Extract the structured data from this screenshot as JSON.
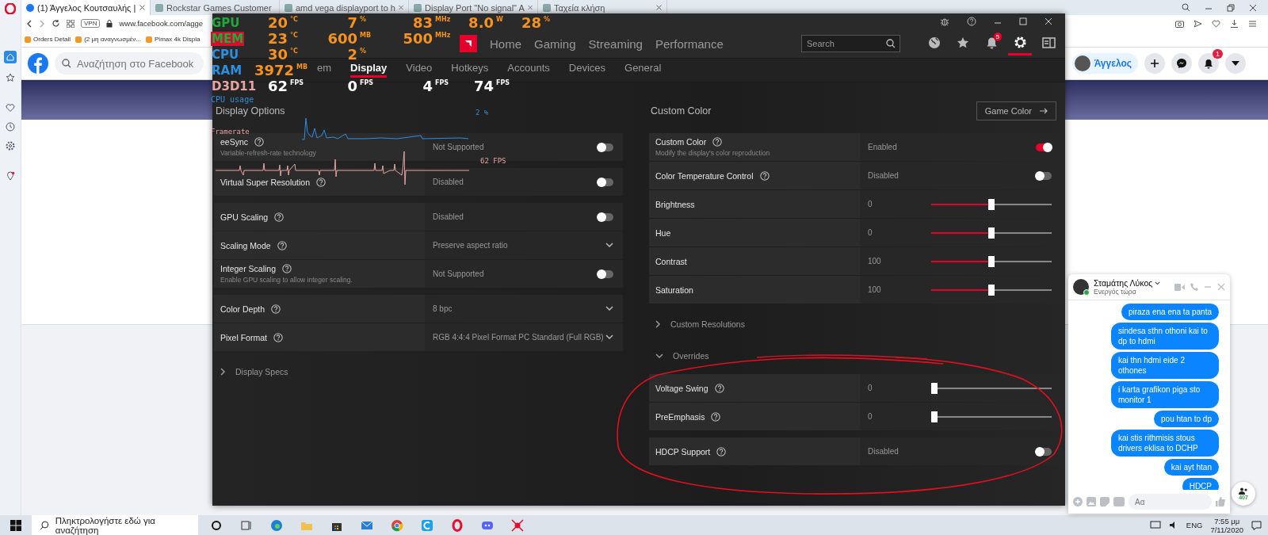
{
  "browser": {
    "tabs": [
      {
        "title": "(1) Άγγελος Κουτσαυλής |",
        "selected": true
      },
      {
        "title": "Rockstar Games Customer",
        "selected": false
      },
      {
        "title": "amd vega displayport to h",
        "selected": false
      },
      {
        "title": "Display Port \"No signal\" A",
        "selected": false
      },
      {
        "title": "Ταχεία κλήση",
        "selected": false
      }
    ],
    "vpn": "VPN",
    "address": "www.facebook.com/agge",
    "bookmarks": [
      {
        "label": "Orders Detail"
      },
      {
        "label": "(2 μη αναγνωσμέν..."
      },
      {
        "label": "Pimax 4k Displa"
      }
    ]
  },
  "facebook": {
    "search_placeholder": "Αναζήτηση στο Facebook",
    "profile_name": "Άγγελος",
    "notification_count": "1"
  },
  "amd": {
    "top_nav": [
      {
        "label": "Home",
        "selected": false
      },
      {
        "label": "Gaming",
        "selected": false
      },
      {
        "label": "Streaming",
        "selected": false
      },
      {
        "label": "Performance",
        "selected": false
      }
    ],
    "search_placeholder": "Search",
    "toolbar": [
      {
        "kind": "globe",
        "selected": false
      },
      {
        "kind": "star",
        "selected": false
      },
      {
        "kind": "bell",
        "badge": "5",
        "selected": false
      },
      {
        "kind": "gear",
        "selected": true
      },
      {
        "kind": "panel",
        "selected": false
      }
    ],
    "sub_tabs": [
      {
        "label": "em",
        "selected": false
      },
      {
        "label": "Display",
        "selected": true
      },
      {
        "label": "Video",
        "selected": false
      },
      {
        "label": "Hotkeys",
        "selected": false
      },
      {
        "label": "Accounts",
        "selected": false
      },
      {
        "label": "Devices",
        "selected": false
      },
      {
        "label": "General",
        "selected": false
      }
    ],
    "left_panel": {
      "title": "Display Options",
      "items": [
        {
          "kind": "group",
          "rows": [
            {
              "kind": "toggle",
              "label": "eeSync",
              "help": true,
              "subtitle": "Variable-refresh-rate technology",
              "value": "Not Supported",
              "on": false
            }
          ]
        },
        {
          "kind": "group",
          "rows": [
            {
              "kind": "toggle",
              "label": "Virtual Super Resolution",
              "help": true,
              "value": "Disabled",
              "on": false
            }
          ]
        },
        {
          "kind": "group",
          "rows": [
            {
              "kind": "toggle",
              "label": "GPU Scaling",
              "help": true,
              "value": "Disabled",
              "on": false
            },
            {
              "kind": "dropdown",
              "label": "Scaling Mode",
              "help": true,
              "value": "Preserve aspect ratio"
            },
            {
              "kind": "toggle",
              "label": "Integer Scaling",
              "help": true,
              "subtitle": "Enable GPU scaling to allow integer scaling.",
              "value": "Not Supported",
              "on": false
            }
          ]
        },
        {
          "kind": "group",
          "rows": [
            {
              "kind": "dropdown",
              "label": "Color Depth",
              "help": true,
              "value": "8 bpc"
            },
            {
              "kind": "dropdown",
              "label": "Pixel Format",
              "help": true,
              "value": "RGB 4:4:4 Pixel Format PC Standard (Full RGB)"
            }
          ]
        },
        {
          "kind": "expander",
          "label": "Display Specs",
          "expanded": false
        }
      ]
    },
    "right_panel": {
      "title": "Custom Color",
      "button": "Game Color",
      "items": [
        {
          "kind": "group",
          "rows": [
            {
              "kind": "toggle",
              "label": "Custom Color",
              "help": true,
              "subtitle": "Modify the display's color reproduction",
              "value": "Enabled",
              "on": true
            },
            {
              "kind": "toggle",
              "label": "Color Temperature Control",
              "help": true,
              "value": "Disabled",
              "on": false
            },
            {
              "kind": "slider",
              "label": "Brightness",
              "help": false,
              "value": "0",
              "level": 0.5
            },
            {
              "kind": "slider",
              "label": "Hue",
              "help": false,
              "value": "0",
              "level": 0.5
            },
            {
              "kind": "slider",
              "label": "Contrast",
              "help": false,
              "value": "100",
              "level": 0.5
            },
            {
              "kind": "slider",
              "label": "Saturation",
              "help": false,
              "value": "100",
              "level": 0.5
            }
          ]
        },
        {
          "kind": "expander",
          "label": "Custom Resolutions",
          "expanded": false
        },
        {
          "kind": "expander",
          "label": "Overrides",
          "expanded": true
        },
        {
          "kind": "group",
          "rows": [
            {
              "kind": "slider",
              "label": "Voltage Swing",
              "help": true,
              "value": "0",
              "level": 0
            },
            {
              "kind": "slider",
              "label": "PreEmphasis",
              "help": true,
              "value": "0",
              "level": 0
            }
          ]
        },
        {
          "kind": "group",
          "rows": [
            {
              "kind": "toggle",
              "label": "HDCP Support",
              "help": true,
              "value": "Disabled",
              "on": false
            }
          ]
        }
      ]
    }
  },
  "osd": {
    "rows": [
      {
        "kind": "gpu",
        "label": "GPU",
        "cells": [
          {
            "value": "20",
            "unit": "°C"
          },
          {
            "value": "7",
            "unit": "%"
          },
          {
            "value": "83",
            "unit": "MHz"
          },
          {
            "value": "8.0",
            "unit": "W"
          },
          {
            "value": "28",
            "unit": "%"
          }
        ]
      },
      {
        "kind": "mem",
        "label": "MEM",
        "cells": [
          {
            "value": "23",
            "unit": "°C"
          },
          {
            "value": "600",
            "unit": "MB"
          },
          {
            "value": "500",
            "unit": "MHz"
          }
        ]
      },
      {
        "kind": "cpu",
        "label": "CPU",
        "cells": [
          {
            "value": "30",
            "unit": "°C"
          },
          {
            "value": "2",
            "unit": "%"
          }
        ]
      },
      {
        "kind": "ram",
        "label": "RAM",
        "cells": [
          {
            "value": "3972",
            "unit": "MB"
          }
        ]
      },
      {
        "kind": "d3d",
        "label": "D3D11",
        "cells": [
          {
            "value": "62",
            "unit": "FPS"
          },
          {
            "value": "0",
            "unit": "FPS"
          },
          {
            "value": "4",
            "unit": "FPS"
          },
          {
            "value": "74",
            "unit": "FPS"
          }
        ]
      }
    ],
    "cpu_graph": {
      "label": "CPU usage",
      "reading": "2 %"
    },
    "fps_graph": {
      "label": "Framerate",
      "reading": "62 FPS"
    }
  },
  "chat": {
    "name": "Σταμάτης Λύκος",
    "status": "Ενεργός τώρα",
    "messages": [
      {
        "text": "piraza ena ena ta panta"
      },
      {
        "text": "sindesa sthn othoni kai to dp to hdmi"
      },
      {
        "text": "kai thn hdmi eide 2 othones"
      },
      {
        "text": "i karta grafikon piga sto monitor 1"
      },
      {
        "text": "pou htan to dp"
      },
      {
        "text": "kai stis rithmisis stous drivers eklisa to DCHP"
      },
      {
        "text": "kai ayt htan"
      },
      {
        "text": "HDCP"
      }
    ],
    "input_placeholder": "Αα",
    "contacts_count": "407"
  },
  "taskbar": {
    "search_placeholder": "Πληκτρολογήστε εδώ για αναζήτηση",
    "language": "ENG",
    "time": "7:55 μμ",
    "date": "7/11/2020"
  }
}
